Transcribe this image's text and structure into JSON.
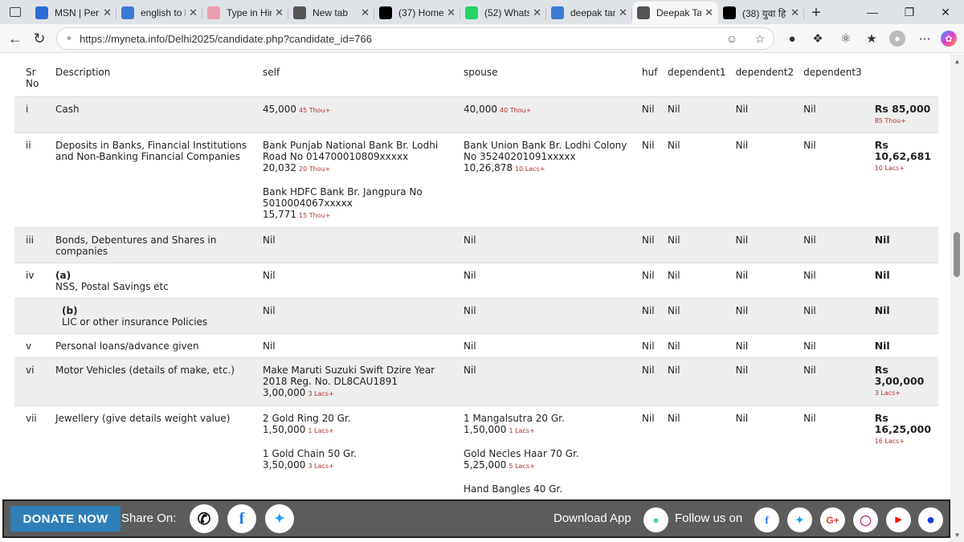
{
  "browser": {
    "tabs": [
      {
        "label": "MSN | Perso",
        "icon": "msn-icon",
        "color": "#2e6bd6"
      },
      {
        "label": "english to h",
        "icon": "search-icon",
        "color": "#3a7bd5"
      },
      {
        "label": "Type in Hin",
        "icon": "hindi-icon",
        "color": "#e8a0b0"
      },
      {
        "label": "New tab",
        "icon": "newtab-icon",
        "color": "#555555"
      },
      {
        "label": "(37) Home",
        "icon": "x-icon",
        "color": "#000000"
      },
      {
        "label": "(52) Whats",
        "icon": "whatsapp-icon",
        "color": "#25d366"
      },
      {
        "label": "deepak tan",
        "icon": "search-icon",
        "color": "#3a7bd5"
      },
      {
        "label": "Deepak Tan",
        "icon": "globe-icon",
        "color": "#555555"
      },
      {
        "label": "(38) युवा हि",
        "icon": "x-icon",
        "color": "#000000"
      }
    ],
    "url": "https://myneta.info/Delhi2025/candidate.php?candidate_id=766"
  },
  "table": {
    "headers": {
      "sr": "Sr No",
      "description": "Description",
      "self": "self",
      "spouse": "spouse",
      "huf": "huf",
      "dependent1": "dependent1",
      "dependent2": "dependent2",
      "dependent3": "dependent3"
    },
    "rows": [
      {
        "sr": "i",
        "description": "Cash",
        "self": [
          {
            "text": "45,000",
            "tag": "45 Thou+"
          }
        ],
        "spouse": [
          {
            "text": "40,000",
            "tag": "40 Thou+"
          }
        ],
        "huf": "Nil",
        "d1": "Nil",
        "d2": "Nil",
        "d3": "Nil",
        "total": "Rs 85,000",
        "total_tag": "85 Thou+"
      },
      {
        "sr": "ii",
        "description": "Deposits in Banks, Financial Institutions and Non-Banking Financial Companies",
        "self": [
          {
            "text": "Bank Punjab National Bank Br. Lodhi Road No 014700010809xxxxx",
            "amount": "20,032",
            "tag": "20 Thou+"
          },
          {
            "text": "Bank HDFC Bank Br. Jangpura No 5010004067xxxxx",
            "amount": "15,771",
            "tag": "15 Thou+"
          }
        ],
        "spouse": [
          {
            "text": "Bank Union Bank Br. Lodhi Colony No 35240201091xxxxx",
            "amount": "10,26,878",
            "tag": "10 Lacs+"
          }
        ],
        "huf": "Nil",
        "d1": "Nil",
        "d2": "Nil",
        "d3": "Nil",
        "total": "Rs 10,62,681",
        "total_tag": "10 Lacs+"
      },
      {
        "sr": "iii",
        "description": "Bonds, Debentures and Shares in companies",
        "self_text": "Nil",
        "spouse_text": "Nil",
        "huf": "Nil",
        "d1": "Nil",
        "d2": "Nil",
        "d3": "Nil",
        "total": "Nil"
      },
      {
        "sr": "iv",
        "subtag": "(a)",
        "description": "NSS, Postal Savings etc",
        "self_text": "Nil",
        "spouse_text": "Nil",
        "huf": "Nil",
        "d1": "Nil",
        "d2": "Nil",
        "d3": "Nil",
        "total": "Nil"
      },
      {
        "sr": "",
        "subtag": "(b)",
        "description": "LIC or other insurance Policies",
        "self_text": "Nil",
        "spouse_text": "Nil",
        "huf": "Nil",
        "d1": "Nil",
        "d2": "Nil",
        "d3": "Nil",
        "total": "Nil"
      },
      {
        "sr": "v",
        "description": "Personal loans/advance given",
        "self_text": "Nil",
        "spouse_text": "Nil",
        "huf": "Nil",
        "d1": "Nil",
        "d2": "Nil",
        "d3": "Nil",
        "total": "Nil"
      },
      {
        "sr": "vi",
        "description": "Motor Vehicles (details of make, etc.)",
        "self": [
          {
            "text": "Make Maruti Suzuki Swift Dzire Year 2018 Reg. No. DL8CAU1891",
            "amount": "3,00,000",
            "tag": "3 Lacs+"
          }
        ],
        "spouse_text": "Nil",
        "huf": "Nil",
        "d1": "Nil",
        "d2": "Nil",
        "d3": "Nil",
        "total": "Rs 3,00,000",
        "total_tag": "3 Lacs+"
      },
      {
        "sr": "vii",
        "description": "Jewellery (give details weight value)",
        "self": [
          {
            "text": "2 Gold Ring 20 Gr.",
            "amount": "1,50,000",
            "tag": "1 Lacs+"
          },
          {
            "text": "1 Gold Chain 50 Gr.",
            "amount": "3,50,000",
            "tag": "3 Lacs+"
          }
        ],
        "spouse": [
          {
            "text": "1 Mangalsutra 20 Gr.",
            "amount": "1,50,000",
            "tag": "1 Lacs+"
          },
          {
            "text": "Gold Necles Haar 70 Gr.",
            "amount": "5,25,000",
            "tag": "5 Lacs+"
          },
          {
            "text": "Hand Bangles 40 Gr."
          }
        ],
        "huf": "Nil",
        "d1": "Nil",
        "d2": "Nil",
        "d3": "Nil",
        "total": "Rs 16,25,000",
        "total_tag": "16 Lacs+"
      }
    ]
  },
  "footer": {
    "donate": "DONATE NOW",
    "share_label": "Share On:",
    "download_label": "Download App",
    "follow_label": "Follow us on"
  }
}
